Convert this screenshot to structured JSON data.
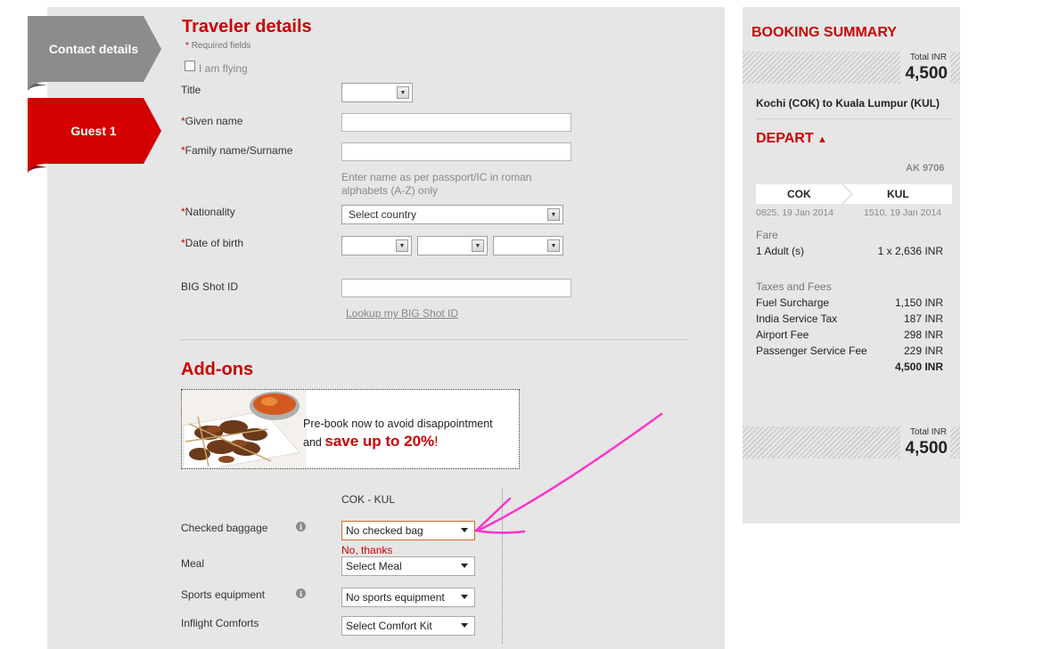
{
  "tabs": [
    {
      "label": "Contact details",
      "active": false
    },
    {
      "label": "Guest 1",
      "active": true
    }
  ],
  "traveler": {
    "title": "Traveler details",
    "required_note": "Required fields",
    "i_am_flying": "I am flying",
    "title_label": "Title",
    "given_name_label": "Given name",
    "family_name_label": "Family name/Surname",
    "name_hint": "Enter name as per passport/IC in roman alphabets (A-Z) only",
    "nationality_label": "Nationality",
    "nationality_value": "Select country",
    "dob_label": "Date of birth",
    "bigshot_label": "BIG Shot ID",
    "bigshot_link": "Lookup my BIG Shot ID"
  },
  "addons": {
    "title": "Add-ons",
    "banner_line1": "Pre-book now to avoid disappointment",
    "banner_line2_prefix": "and",
    "banner_line2_highlight": "save up to 20%",
    "banner_line2_suffix": "!",
    "route": "COK - KUL",
    "checked_baggage_label": "Checked baggage",
    "checked_baggage_value": "No checked bag",
    "checked_baggage_note": "No, thanks",
    "meal_label": "Meal",
    "meal_value": "Select Meal",
    "sports_label": "Sports equipment",
    "sports_value": "No sports equipment",
    "comfort_label": "Inflight Comforts",
    "comfort_value": "Select Comfort Kit"
  },
  "summary": {
    "title": "BOOKING SUMMARY",
    "total_label": "Total",
    "currency": "INR",
    "total_value": "4,500",
    "route_title": "Kochi (COK) to Kuala Lumpur (KUL)",
    "depart_label": "DEPART",
    "flight_no": "AK 9706",
    "from_code": "COK",
    "to_code": "KUL",
    "from_time": "0825, 19 Jan 2014",
    "to_time": "1510, 19 Jan 2014",
    "fare_label": "Fare",
    "adults_label": "1 Adult (s)",
    "adults_value": "1 x 2,636 INR",
    "taxes_label": "Taxes and Fees",
    "fees": [
      {
        "label": "Fuel Surcharge",
        "value": "1,150 INR"
      },
      {
        "label": "India Service Tax",
        "value": "187 INR"
      },
      {
        "label": "Airport Fee",
        "value": "298 INR"
      },
      {
        "label": "Passenger Service Fee",
        "value": "229 INR"
      }
    ],
    "subtotal": "4,500 INR"
  },
  "colors": {
    "accent_red": "#cc0000",
    "tab_grey": "#8c8c8c",
    "annotation_magenta": "#ff33cc"
  }
}
